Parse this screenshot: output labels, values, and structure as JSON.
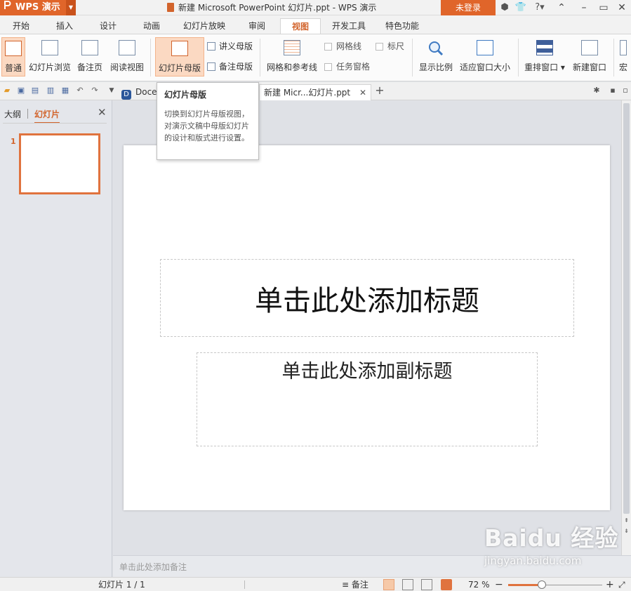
{
  "titlebar": {
    "app_label": "WPS 演示",
    "window_title": "新建 Microsoft PowerPoint 幻灯片.ppt - WPS 演示",
    "login": "未登录"
  },
  "menu_tabs": [
    "开始",
    "插入",
    "设计",
    "动画",
    "幻灯片放映",
    "审阅",
    "视图",
    "开发工具",
    "特色功能"
  ],
  "active_tab": "视图",
  "ribbon": {
    "normal": "普通",
    "slide_sorter": "幻灯片浏览",
    "notes_page": "备注页",
    "reading_view": "阅读视图",
    "slide_master": "幻灯片母版",
    "handout_master": "讲义母版",
    "notes_master": "备注母版",
    "grid_guides": "网格和参考线",
    "gridlines": "网格线",
    "ruler": "标尺",
    "task_pane": "任务窗格",
    "zoom": "显示比例",
    "fit_window": "适应窗口大小",
    "arrange": "重排窗口",
    "new_window": "新建窗口",
    "macro": "宏"
  },
  "doc_tabs": {
    "first": "Doce",
    "second": "新建 Micr...幻灯片.ppt"
  },
  "tooltip": {
    "title": "幻灯片母版",
    "body": "切换到幻灯片母版视图，对演示文稿中母版幻灯片的设计和版式进行设置。"
  },
  "leftpane": {
    "outline_tab": "大纲",
    "slides_tab": "幻灯片",
    "thumb_number": "1"
  },
  "slide": {
    "title_placeholder": "单击此处添加标题",
    "subtitle_placeholder": "单击此处添加副标题"
  },
  "notes": {
    "placeholder": "单击此处添加备注"
  },
  "status": {
    "slide_counter": "幻灯片 1 / 1",
    "notes_toggle": "备注",
    "zoom_percent": "72 %",
    "zoom_value": 0.72
  },
  "watermark": {
    "logo": "Baidu 经验",
    "url": "jingyan.baidu.com"
  },
  "colors": {
    "accent": "#e0652a",
    "active_tab_text": "#d2642c"
  }
}
